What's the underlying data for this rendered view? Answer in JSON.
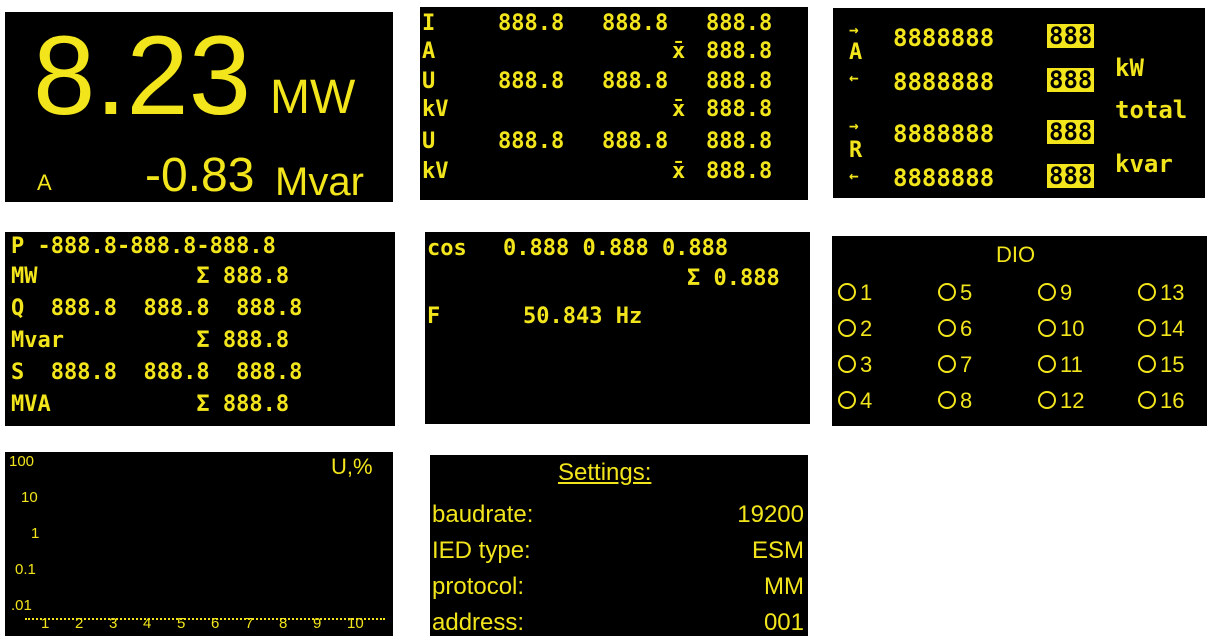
{
  "palette": {
    "background": "#000000",
    "text": "#f2e51c",
    "page": "#ffffff"
  },
  "p1": {
    "big_value": "8.23",
    "big_unit": "MW",
    "phase": "A",
    "small_value": "-0.83",
    "small_unit": "Mvar"
  },
  "p2": {
    "labels": [
      "I",
      "A",
      "U",
      "kV",
      "U",
      "kV"
    ],
    "rows": [
      [
        "888.8",
        "888.8",
        "888.8"
      ],
      [
        "x̄",
        "888.8"
      ],
      [
        "888.8",
        "888.8",
        "888.8"
      ],
      [
        "x̄",
        "888.8"
      ],
      [
        "888.8",
        "888.8",
        "888.8"
      ],
      [
        "x̄",
        "888.8"
      ]
    ]
  },
  "p3": {
    "rows": [
      {
        "arrow": "→",
        "label": "A",
        "digits": "8888888",
        "hl": "888",
        "unit": "kW"
      },
      {
        "arrow": "←",
        "label": "",
        "digits": "8888888",
        "hl": "888",
        "unit": ""
      },
      {
        "arrow": "→",
        "label": "R",
        "digits": "8888888",
        "hl": "888",
        "unit": "total"
      },
      {
        "arrow": "←",
        "label": "",
        "digits": "8888888",
        "hl": "888",
        "unit": "kvar"
      }
    ]
  },
  "p4": {
    "lines": [
      "P -888.8-888.8-888.8",
      "MW            Σ 888.8",
      "Q  888.8  888.8  888.8",
      "Mvar          Σ 888.8",
      "S  888.8  888.8  888.8",
      "MVA           Σ 888.8"
    ]
  },
  "p5": {
    "cos_label": "cos",
    "cos_values": "0.888 0.888 0.888",
    "sum": "Σ 0.888",
    "f_label": "F",
    "f_value": "50.843 Hz"
  },
  "p6": {
    "title": "DIO",
    "items": [
      "1",
      "5",
      "9",
      "13",
      "2",
      "6",
      "10",
      "14",
      "3",
      "7",
      "11",
      "15",
      "4",
      "8",
      "12",
      "16"
    ]
  },
  "p7": {
    "title": "U,%",
    "y_ticks": [
      "100",
      "10",
      "1",
      "0.1",
      ".01"
    ],
    "x_ticks": [
      "1",
      "2",
      "3",
      "4",
      "5",
      "6",
      "7",
      "8",
      "9",
      "10"
    ]
  },
  "p8": {
    "title": "Settings:",
    "rows": [
      {
        "label": "baudrate:",
        "value": "19200"
      },
      {
        "label": "IED type:",
        "value": "ESM"
      },
      {
        "label": "protocol:",
        "value": "MM"
      },
      {
        "label": "address:",
        "value": "001"
      }
    ]
  }
}
